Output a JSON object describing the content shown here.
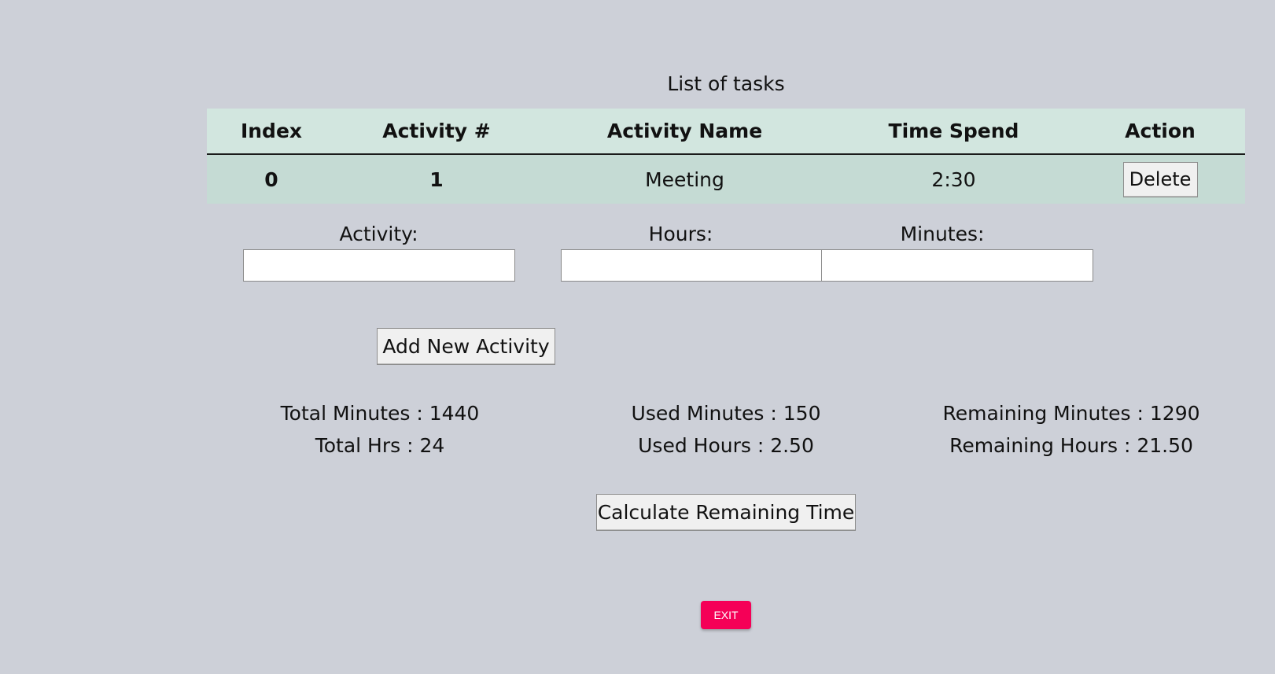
{
  "table": {
    "caption": "List of tasks",
    "headers": [
      "Index",
      "Activity #",
      "Activity Name",
      "Time Spend",
      "Action"
    ],
    "rows": [
      {
        "index": "0",
        "activity_no": "1",
        "name": "Meeting",
        "time": "2:30",
        "action": "Delete"
      }
    ]
  },
  "form": {
    "activity_label": "Activity:",
    "activity_value": "",
    "hours_label": "Hours:",
    "hours_value": "",
    "minutes_label": "Minutes:",
    "minutes_value": "",
    "add_button": "Add New Activity"
  },
  "stats": {
    "total_minutes": "Total Minutes : 1440",
    "total_hrs": "Total Hrs : 24",
    "used_minutes": "Used Minutes : 150",
    "used_hours": "Used Hours : 2.50",
    "remaining_minutes": "Remaining Minutes : 1290",
    "remaining_hours": "Remaining Hours : 21.50"
  },
  "calculate_button": "Calculate Remaining Time",
  "exit_button": "EXIT",
  "colors": {
    "background": "#cdd0d8",
    "header_row": "#d2e6df",
    "data_row": "#c5dbd4",
    "exit": "#f50057"
  }
}
